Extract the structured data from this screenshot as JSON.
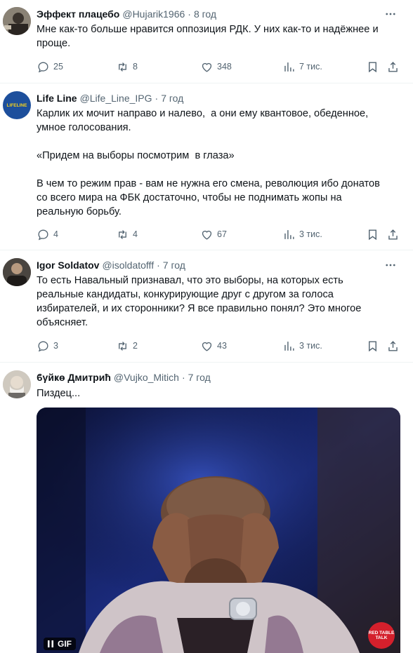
{
  "tweets": [
    {
      "name": "Эффект плацебо",
      "handle": "@Hujarik1966",
      "time": "8 год",
      "text": "Мне как-то больше нравится оппозиция РДК. У них как-то и надёжнее и\nпроще.",
      "replies": "25",
      "retweets": "8",
      "likes": "348",
      "views": "7 тис."
    },
    {
      "name": "Life Line",
      "handle": "@Life_Line_IPG",
      "time": "7 год",
      "avatar_text": "LIFELINE",
      "text": "Карлик их мочит направо и налево,  а они ему квантовое, обеденное,\nумное голосования.\n\n«Придем на выборы посмотрим  в глаза»\n\nВ чем то режим прав - вам не нужна его смена, революция ибо донатов\nсо всего мира на ФБК достаточно, чтобы не поднимать жопы на\nреальную борьбу.",
      "replies": "4",
      "retweets": "4",
      "likes": "67",
      "views": "3 тис."
    },
    {
      "name": "Igor Soldatov",
      "handle": "@isoldatofff",
      "time": "7 год",
      "text": "То есть Навальный признавал, что это выборы, на которых есть\nреальные кандидаты, конкурирующие друг с другом за голоса\nизбирателей, и их сторонники? Я все правильно понял? Это многое\nобъясняет.",
      "replies": "3",
      "retweets": "2",
      "likes": "43",
      "views": "3 тис."
    },
    {
      "name": "ϐγйҝө Дмитрић",
      "handle": "@Vujko_Mitich",
      "time": "7 год",
      "text": "Пиздец...",
      "gif_label": "GIF",
      "watermark": "RED TABLE TALK"
    }
  ],
  "colors": {
    "text": "#0f1419",
    "secondary": "#536471",
    "divider": "#eff3f4",
    "lifeline_blue": "#1d4f9c",
    "lifeline_yellow": "#f5d21c"
  },
  "icons": [
    "reply-icon",
    "retweet-icon",
    "like-icon",
    "views-icon",
    "bookmark-icon",
    "share-icon",
    "more-icon"
  ]
}
